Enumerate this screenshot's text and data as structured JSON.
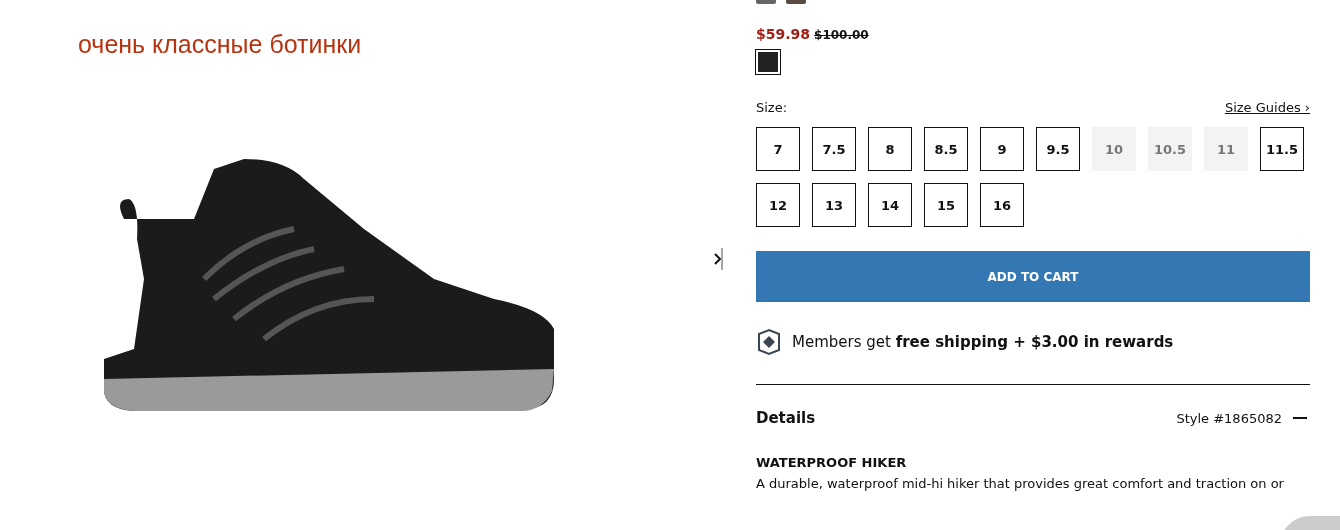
{
  "headline": "очень классные ботинки",
  "price": {
    "sale": "$59.98",
    "original": "$100.00"
  },
  "swatches": [
    {
      "color": "#222222",
      "selected": true
    }
  ],
  "size": {
    "label": "Size:",
    "guide_link": "Size Guides ›",
    "options": [
      {
        "label": "7",
        "available": true
      },
      {
        "label": "7.5",
        "available": true
      },
      {
        "label": "8",
        "available": true
      },
      {
        "label": "8.5",
        "available": true
      },
      {
        "label": "9",
        "available": true
      },
      {
        "label": "9.5",
        "available": true
      },
      {
        "label": "10",
        "available": false
      },
      {
        "label": "10.5",
        "available": false
      },
      {
        "label": "11",
        "available": false
      },
      {
        "label": "11.5",
        "available": true
      },
      {
        "label": "12",
        "available": true
      },
      {
        "label": "13",
        "available": true
      },
      {
        "label": "14",
        "available": true
      },
      {
        "label": "15",
        "available": true
      },
      {
        "label": "16",
        "available": true
      }
    ]
  },
  "add_to_cart": "ADD TO CART",
  "rewards": "Members get **free shipping + $3.00 in rewards**",
  "details": {
    "title": "Details",
    "style": "Style #1865082",
    "expanded": true,
    "heading": "WATERPROOF HIKER",
    "text": "A durable, waterproof mid-hi hiker that provides great comfort and traction on or"
  }
}
